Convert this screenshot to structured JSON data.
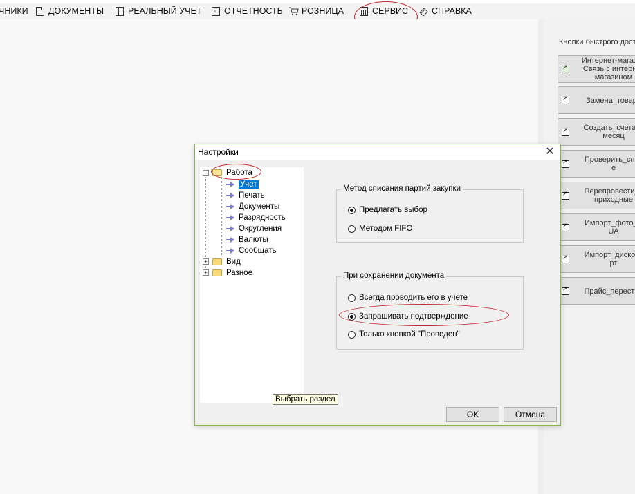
{
  "menu": {
    "items": [
      {
        "label": "ЧНИКИ",
        "icon": ""
      },
      {
        "label": "ДОКУМЕНТЫ",
        "icon": "document-icon"
      },
      {
        "label": "РЕАЛЬНЫЙ УЧЕТ",
        "icon": "grid-icon"
      },
      {
        "label": "ОТЧЕТНОСТЬ",
        "icon": "report-icon"
      },
      {
        "label": "РОЗНИЦА",
        "icon": "cart-icon"
      },
      {
        "label": "СЕРВИС",
        "icon": "calendar-icon"
      },
      {
        "label": "СПРАВКА",
        "icon": "book-icon"
      }
    ]
  },
  "quick_access": {
    "title": "Кнопки быстрого дост",
    "buttons": [
      {
        "lines": [
          "Интернет-магазин",
          "Связь с интернет",
          "магазином"
        ]
      },
      {
        "lines": [
          "Замена_товара"
        ]
      },
      {
        "lines": [
          "Создать_счета_з",
          "месяц"
        ]
      },
      {
        "lines": [
          "Проверить_спис",
          "е"
        ]
      },
      {
        "lines": [
          "Перепровести_в",
          "приходные"
        ]
      },
      {
        "lines": [
          "Импорт_фото_Р",
          "UA"
        ]
      },
      {
        "lines": [
          "Импорт_дисконт",
          "рт"
        ]
      },
      {
        "lines": [
          "Прайс_перестро"
        ]
      }
    ]
  },
  "dialog": {
    "title": "Настройки",
    "close_symbol": "✕",
    "tree": {
      "root_work": "Работа",
      "children": [
        "Учет",
        "Печать",
        "Документы",
        "Разрядность",
        "Округления",
        "Валюты",
        "Сообщать"
      ],
      "selected_child": "Учет",
      "root_view": "Вид",
      "root_misc": "Разное",
      "expander_expanded": "−",
      "expander_collapsed": "+"
    },
    "tooltip": "Выбрать раздел",
    "group_write_off": {
      "title": "Метод списания партий закупки",
      "options": [
        "Предлагать выбор",
        "Методом FIFO"
      ],
      "selected_index": 0
    },
    "group_on_save": {
      "title": "При сохранении документа",
      "options": [
        "Всегда проводить его в учете",
        "Запрашивать подтверждение",
        "Только кнопкой \"Проведен\""
      ],
      "selected_index": 1
    },
    "ok_label": "OK",
    "cancel_label": "Отмена"
  }
}
